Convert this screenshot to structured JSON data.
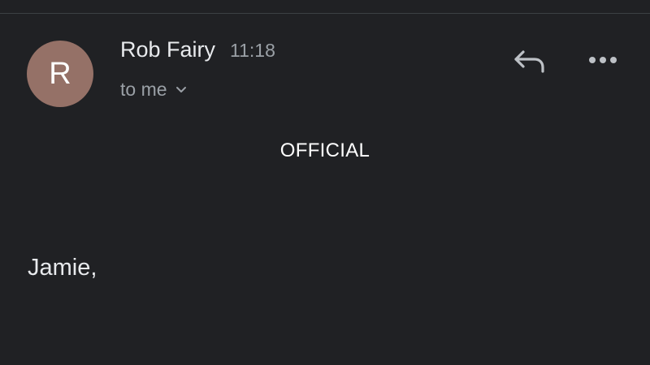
{
  "email": {
    "sender": {
      "initial": "R",
      "name": "Rob Fairy",
      "time": "11:18",
      "avatar_color": "#957167"
    },
    "recipient_label": "to me",
    "classification": "OFFICIAL",
    "body": {
      "greeting": "Jamie,"
    }
  },
  "icons": {
    "reply": "reply-icon",
    "more": "more-options-icon",
    "expand": "chevron-down-icon"
  },
  "colors": {
    "background": "#202124",
    "primary_text": "#e8eaed",
    "secondary_text": "#9aa0a6"
  }
}
